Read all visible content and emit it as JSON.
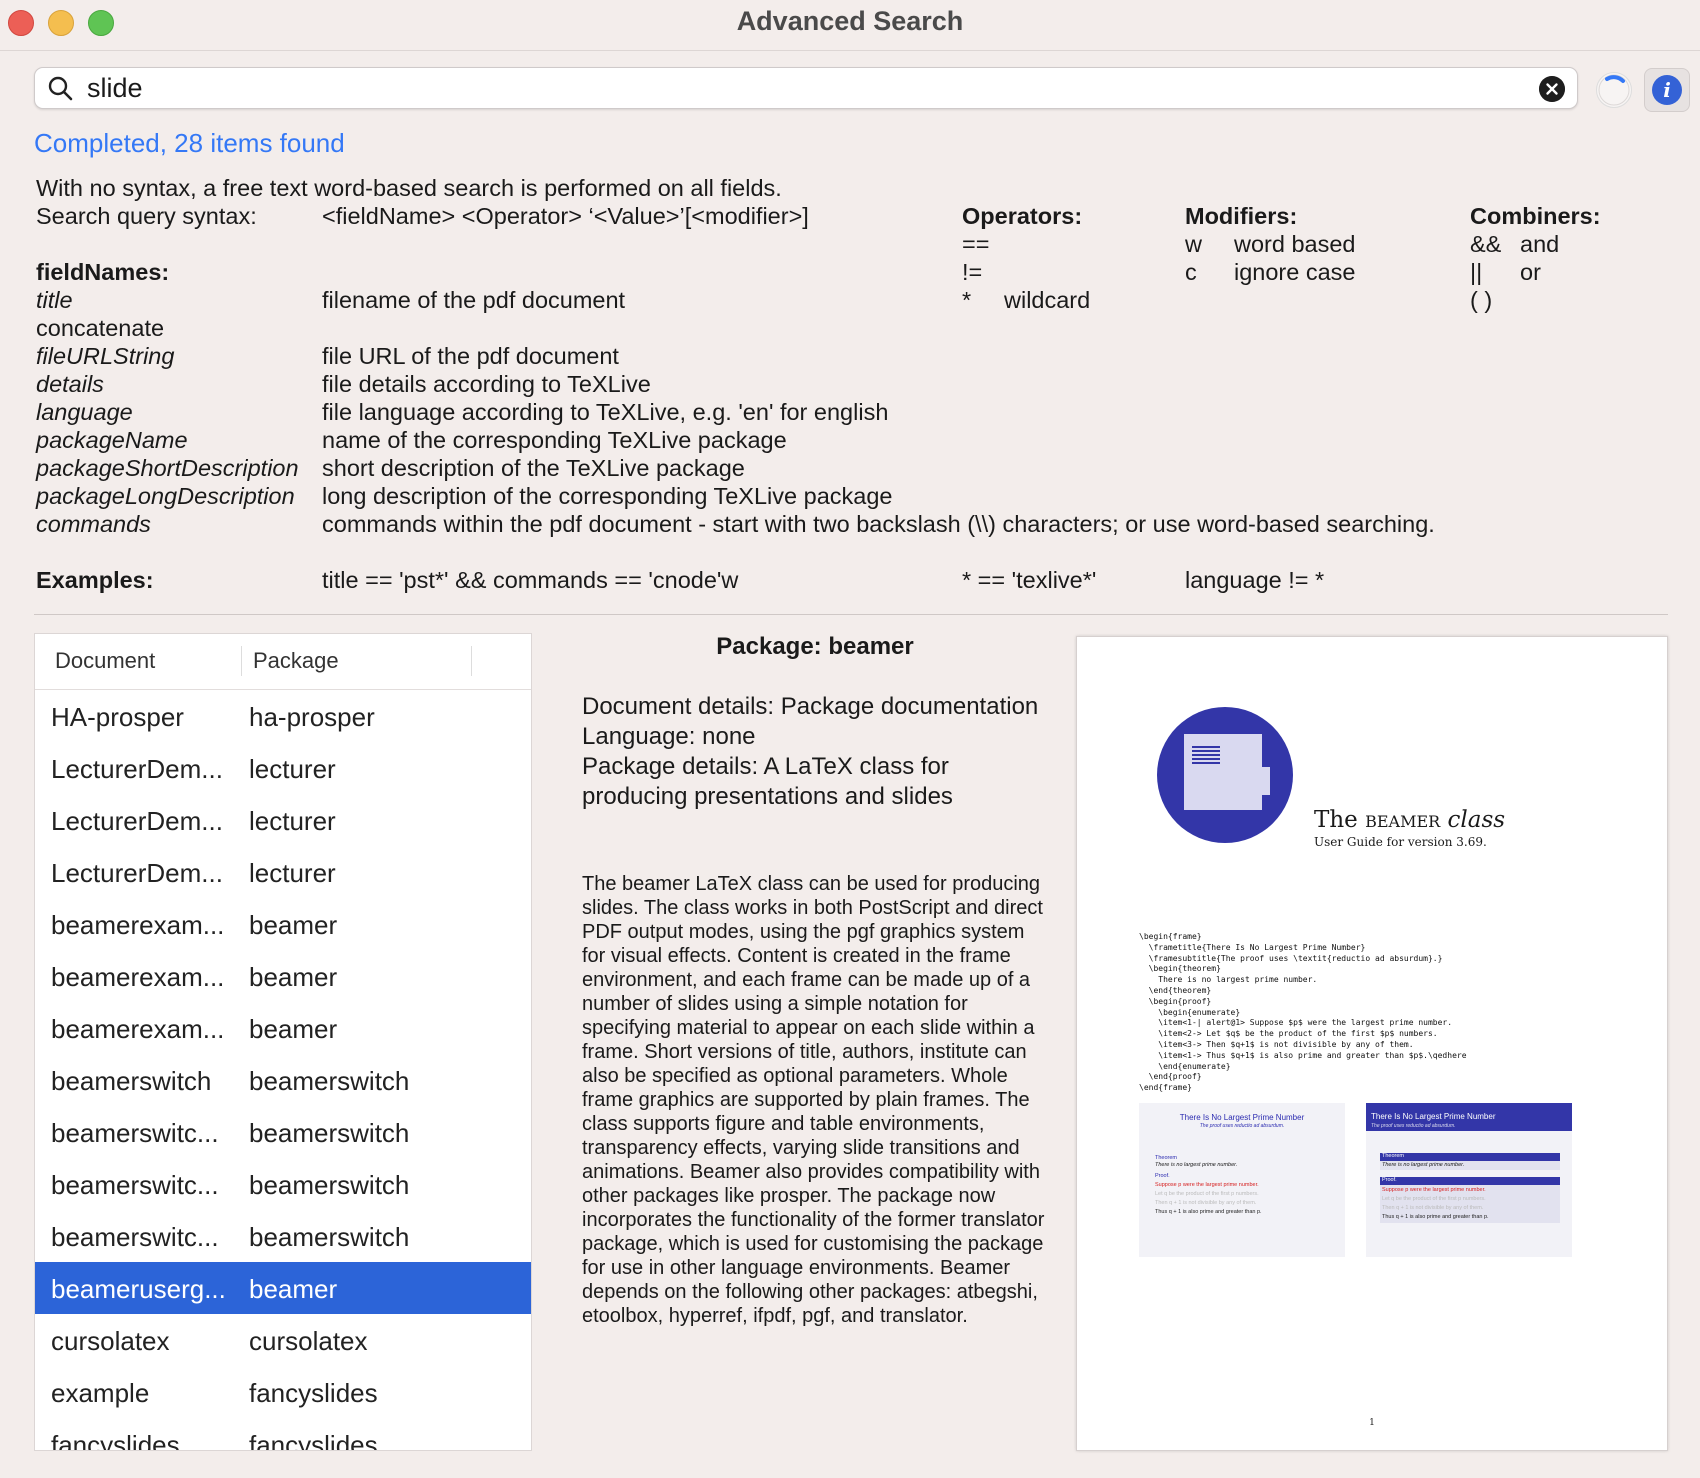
{
  "window": {
    "title": "Advanced Search"
  },
  "search": {
    "value": "slide",
    "placeholder": ""
  },
  "status": "Completed, 28 items found",
  "help": {
    "intro": "With no syntax, a free text word-based search is performed on all fields.",
    "syntax_label": "Search query syntax:",
    "syntax": "<fieldName>  <Operator>  ‘<Value>’[<modifier>]",
    "fieldnames_heading": "fieldNames:",
    "fields": [
      {
        "name": "title",
        "desc": "filename of the pdf document"
      },
      {
        "name": "concatenate",
        "desc": ""
      },
      {
        "name": "fileURLString",
        "desc": "file URL of the pdf document"
      },
      {
        "name": "details",
        "desc": "file details according to TeXLive"
      },
      {
        "name": "language",
        "desc": "file language according to TeXLive, e.g. 'en' for english"
      },
      {
        "name": "packageName",
        "desc": "name of the corresponding TeXLive package"
      },
      {
        "name": "packageShortDescription",
        "desc": "short description of the TeXLive package"
      },
      {
        "name": "packageLongDescription",
        "desc": "long description of the corresponding TeXLive package"
      },
      {
        "name": "commands",
        "desc": "commands within the pdf document - start with two backslash (\\\\) characters; or use word-based searching."
      }
    ],
    "operators_heading": "Operators:",
    "operators": [
      {
        "sym": "==",
        "desc": ""
      },
      {
        "sym": "!=",
        "desc": ""
      },
      {
        "sym": "*",
        "desc": "wildcard"
      }
    ],
    "modifiers_heading": "Modifiers:",
    "modifiers": [
      {
        "sym": "w",
        "desc": "word based"
      },
      {
        "sym": "c",
        "desc": "ignore case"
      }
    ],
    "combiners_heading": "Combiners:",
    "combiners": [
      {
        "sym": "&&",
        "desc": "and"
      },
      {
        "sym": "||",
        "desc": "or"
      },
      {
        "sym": "( )",
        "desc": ""
      }
    ],
    "examples_heading": "Examples:",
    "examples": [
      "title == 'pst*' && commands == 'cnode'w",
      "* == 'texlive*'",
      "language != *"
    ]
  },
  "table": {
    "columns": [
      "Document",
      "Package"
    ],
    "rows": [
      {
        "document": "HA-prosper",
        "package": "ha-prosper"
      },
      {
        "document": "LecturerDem...",
        "package": "lecturer"
      },
      {
        "document": "LecturerDem...",
        "package": "lecturer"
      },
      {
        "document": "LecturerDem...",
        "package": "lecturer"
      },
      {
        "document": "beamerexam...",
        "package": "beamer"
      },
      {
        "document": "beamerexam...",
        "package": "beamer"
      },
      {
        "document": "beamerexam...",
        "package": "beamer"
      },
      {
        "document": "beamerswitch",
        "package": "beamerswitch"
      },
      {
        "document": "beamerswitc...",
        "package": "beamerswitch"
      },
      {
        "document": "beamerswitc...",
        "package": "beamerswitch"
      },
      {
        "document": "beamerswitc...",
        "package": "beamerswitch"
      },
      {
        "document": "beameruserg...",
        "package": "beamer",
        "selected": true
      },
      {
        "document": "cursolatex",
        "package": "cursolatex"
      },
      {
        "document": "example",
        "package": "fancyslides"
      },
      {
        "document": "fancyslides",
        "package": "fancyslides"
      }
    ]
  },
  "detail": {
    "title": "Package: beamer",
    "document_details": "Document details: Package documentation",
    "language": "Language: none",
    "package_details": "Package details: A LaTeX class for producing presentations and slides",
    "description": "The beamer LaTeX class can be used for producing slides. The class works in both PostScript and direct PDF output modes, using the pgf graphics system for visual effects. Content is created in the frame environment, and each frame can be made up of a number of slides using a simple notation for specifying material to appear on each slide within a frame. Short versions of title, authors, institute can also be specified as optional parameters. Whole frame graphics are supported by plain frames. The class supports figure and table environments, transparency effects, varying slide transitions and animations. Beamer also provides compatibility with other packages like prosper. The package now incorporates the functionality of the former translator package, which is used for customising the package for use in other language environments. Beamer depends on the following other packages: atbegshi, etoolbox, hyperref, ifpdf, pgf, and translator."
  },
  "preview": {
    "title_pre": "The ",
    "title_sc": "beamer",
    "title_post": " class",
    "subtitle": "User Guide for version 3.69.",
    "code_lines": [
      "\\begin{frame}",
      "  \\frametitle{There Is No Largest Prime Number}",
      "  \\framesubtitle{The proof uses \\textit{reductio ad absurdum}.}",
      "  \\begin{theorem}",
      "    There is no largest prime number.",
      "  \\end{theorem}",
      "  \\begin{proof}",
      "    \\begin{enumerate}",
      "    \\item<1-| alert@1> Suppose $p$ were the largest prime number.",
      "    \\item<2-> Let $q$ be the product of the first $p$ numbers.",
      "    \\item<3-> Then $q+1$ is not divisible by any of them.",
      "    \\item<1-> Thus $q+1$ is also prime and greater than $p$.\\qedhere",
      "    \\end{enumerate}",
      "  \\end{proof}",
      "\\end{frame}"
    ],
    "slide_title": "There Is No Largest Prime Number",
    "slide_subtitle": "The proof uses reductio ad absurdum.",
    "theorem_label": "Theorem",
    "theorem_text": "There is no largest prime number.",
    "proof_label": "Proof.",
    "items": [
      "Suppose p were the largest prime number.",
      "Let q be the product of the first p numbers.",
      "Then q + 1 is not divisible by any of them.",
      "Thus q + 1 is also prime and greater than p."
    ],
    "page_number": "1"
  },
  "colors": {
    "accent": "#3478f6",
    "selection": "#2c64d8",
    "beamer_blue": "#3336a8"
  }
}
